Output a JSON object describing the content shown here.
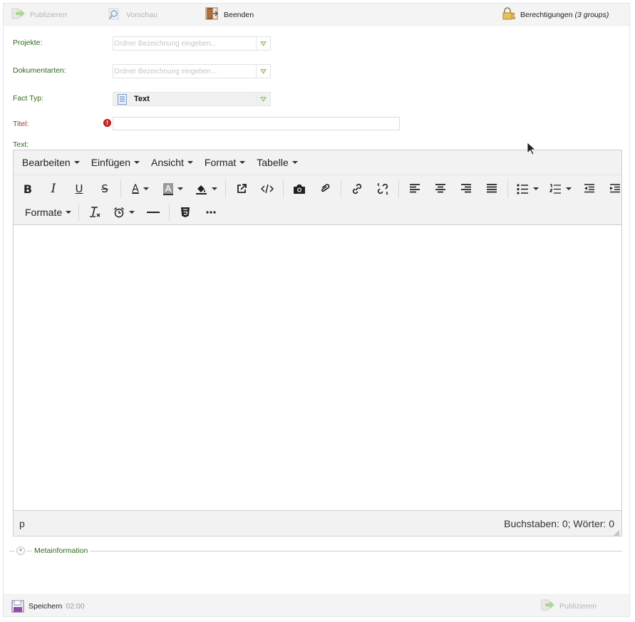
{
  "top_toolbar": {
    "publish_label": "Publizieren",
    "preview_label": "Vorschau",
    "exit_label": "Beenden",
    "permissions_label": "Berechtigungen",
    "permissions_count": "(3 groups)"
  },
  "form": {
    "projects_label": "Projekte:",
    "projects_placeholder": "Ordner Bezeichnung eingeben...",
    "doctypes_label": "Dokumentarten:",
    "doctypes_placeholder": "Ordner Bezeichnung eingeben...",
    "facttype_label": "Fact Typ:",
    "facttype_value": "Text",
    "title_label": "Titel:",
    "title_value": "",
    "text_label": "Text:"
  },
  "editor": {
    "menu": [
      "Bearbeiten",
      "Einfügen",
      "Ansicht",
      "Format",
      "Tabelle"
    ],
    "formats_label": "Formate",
    "status_path": "p",
    "word_count": "Buchstaben: 0; Wörter: 0"
  },
  "meta": {
    "label": "Metainformation"
  },
  "bottom_bar": {
    "save_label": "Speichern",
    "save_time": "02:00",
    "publish_label": "Publizieren"
  },
  "colors": {
    "label_green": "#2e6a1c",
    "label_required": "#9a3a2a",
    "disabled_text": "#b5b5b5",
    "error_red": "#d12a2a"
  }
}
